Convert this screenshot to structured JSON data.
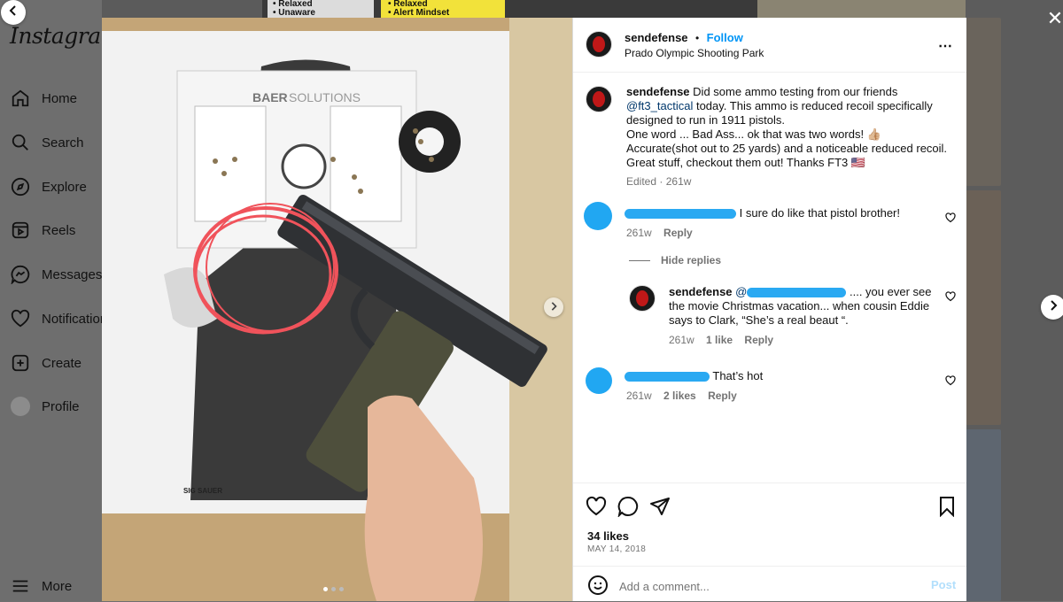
{
  "brand": {
    "logo_text": "Instagram"
  },
  "nav": [
    {
      "label": "Home",
      "icon": "home-icon"
    },
    {
      "label": "Search",
      "icon": "search-icon"
    },
    {
      "label": "Explore",
      "icon": "explore-icon"
    },
    {
      "label": "Reels",
      "icon": "reels-icon"
    },
    {
      "label": "Messages",
      "icon": "messages-icon"
    },
    {
      "label": "Notification",
      "icon": "notifications-icon"
    },
    {
      "label": "Create",
      "icon": "create-icon"
    },
    {
      "label": "Profile",
      "icon": "profile-icon"
    },
    {
      "label": "More",
      "icon": "menu-icon"
    }
  ],
  "background": {
    "sign1": [
      "• Relaxed",
      "• Unaware"
    ],
    "sign2": [
      "• Relaxed",
      "• Alert Mindset"
    ]
  },
  "post": {
    "author": "sendefense",
    "follow_label": "Follow",
    "separator": "•",
    "location": "Prado Olympic Shooting Park",
    "caption": {
      "author": "sendefense",
      "line1": "Did some ammo testing from our friends",
      "mention": "@ft3_tactical",
      "line2": " today. This ammo is reduced recoil specifically designed to run in 1911 pistols.",
      "line3": "One word ... Bad Ass... ok that was two words! 👍🏼",
      "line4": "Accurate(shot out to 25 yards) and a noticeable reduced recoil. Great stuff, checkout them out! Thanks FT3 🇺🇸",
      "edited": "Edited",
      "dot": "·",
      "time": "261w"
    },
    "comments": [
      {
        "text": "I sure do like that pistol brother!",
        "time": "261w",
        "reply_label": "Reply"
      },
      {
        "hide_replies": "Hide replies"
      },
      {
        "author": "sendefense",
        "mention_prefix": "@",
        "text": ".... you ever see the movie Christmas vacation... when cousin Eddie says to Clark, “She’s a real beaut “.",
        "time": "261w",
        "likes": "1 like",
        "reply_label": "Reply"
      },
      {
        "text": "That’s hot",
        "time": "261w",
        "likes": "2 likes",
        "reply_label": "Reply"
      }
    ],
    "likes": "34 likes",
    "date": "MAY 14, 2018",
    "comment_placeholder": "Add a comment...",
    "post_label": "Post"
  },
  "photo": {
    "target_brand": "BAER SOLUTIONS",
    "target_brand_bold": "BAER",
    "target_brand_light": "SOLUTIONS",
    "sig_label": "SIG SAUER",
    "carousel_count": 3,
    "carousel_active": 0
  },
  "colors": {
    "accent": "#0095f6",
    "redaction": "#2aa9f2",
    "circle": "#f0535b"
  }
}
